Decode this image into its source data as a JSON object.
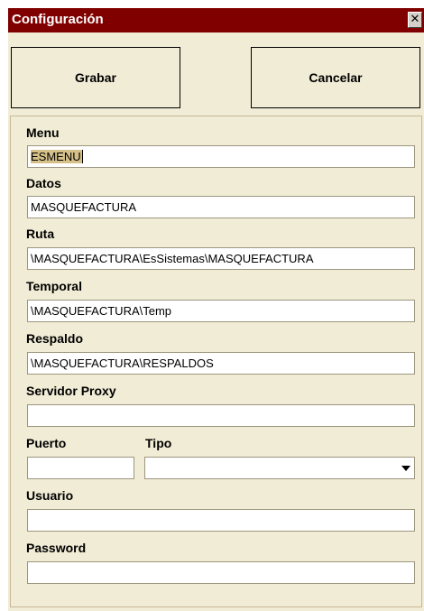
{
  "window": {
    "title": "Configuración",
    "close_glyph": "✕"
  },
  "buttons": {
    "save_label": "Grabar",
    "cancel_label": "Cancelar"
  },
  "fields": {
    "menu": {
      "label": "Menu",
      "value": "ESMENU"
    },
    "datos": {
      "label": "Datos",
      "value": "MASQUEFACTURA"
    },
    "ruta": {
      "label": "Ruta",
      "value": "\\MASQUEFACTURA\\EsSistemas\\MASQUEFACTURA"
    },
    "temporal": {
      "label": "Temporal",
      "value": "\\MASQUEFACTURA\\Temp"
    },
    "respaldo": {
      "label": "Respaldo",
      "value": "\\MASQUEFACTURA\\RESPALDOS"
    },
    "servidor_proxy": {
      "label": "Servidor Proxy",
      "value": ""
    },
    "puerto": {
      "label": "Puerto",
      "value": ""
    },
    "tipo": {
      "label": "Tipo",
      "value": ""
    },
    "usuario": {
      "label": "Usuario",
      "value": ""
    },
    "password": {
      "label": "Password",
      "value": ""
    }
  },
  "colors": {
    "titlebar": "#800000",
    "panel": "#f1ecd5",
    "selection": "#d6c089"
  },
  "icons": {
    "close": "close-icon",
    "combo": "chevron-down-icon"
  }
}
